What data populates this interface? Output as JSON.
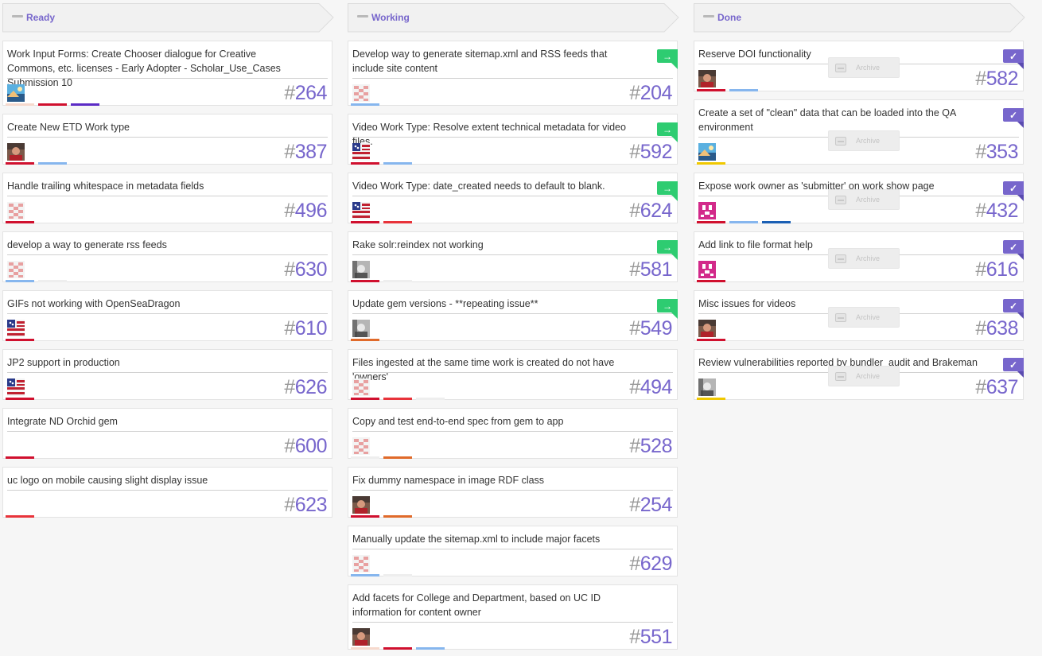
{
  "colors": {
    "accent": "#7766cc",
    "move_badge": "#2ecc71",
    "done_badge": "#7766cc",
    "label_red": "#d0102e",
    "label_lightred": "#e8333a",
    "label_purple": "#5b2bc5",
    "label_lightblue": "#86b6ee",
    "label_blue": "#1a5fb4",
    "label_orange": "#e06a2a",
    "label_yellow": "#f0c800",
    "label_grey": "#eeeeee",
    "label_peach": "#f6d9cd"
  },
  "columns": [
    {
      "key": "ready",
      "title": "Ready",
      "cards": [
        {
          "title": "Work Input Forms: Create Chooser dialogue for Creative Commons, etc. licenses - Early Adopter - Scholar_Use_Cases Submission 10",
          "number": "264",
          "avatar": "landscape",
          "labels": [
            "label_peach",
            "label_red",
            "label_purple"
          ]
        },
        {
          "title": "Create New ETD Work type",
          "number": "387",
          "avatar": "person",
          "labels": [
            "label_red",
            "label_lightblue"
          ]
        },
        {
          "title": "Handle trailing whitespace in metadata fields",
          "number": "496",
          "avatar": "identicon-pink",
          "labels": [
            "label_red"
          ]
        },
        {
          "title": "develop a way to generate rss feeds",
          "number": "630",
          "avatar": "identicon-pink",
          "labels": [
            "label_lightblue",
            "label_grey"
          ]
        },
        {
          "title": "GIFs not working with OpenSeaDragon",
          "number": "610",
          "avatar": "flag",
          "labels": [
            "label_red"
          ]
        },
        {
          "title": "JP2 support in production",
          "number": "626",
          "avatar": "flag",
          "labels": [
            "label_red"
          ]
        },
        {
          "title": "Integrate ND Orchid gem",
          "number": "600",
          "avatar": "none",
          "labels": [
            "label_red"
          ]
        },
        {
          "title": "uc logo on mobile causing slight display issue",
          "number": "623",
          "avatar": "none",
          "labels": [
            "label_lightred"
          ]
        }
      ]
    },
    {
      "key": "working",
      "title": "Working",
      "cards": [
        {
          "title": "Develop way to generate sitemap.xml and RSS feeds that include site content",
          "number": "204",
          "avatar": "identicon-pink",
          "labels": [
            "label_lightblue"
          ],
          "badge": "move"
        },
        {
          "title": "Video Work Type: Resolve extent technical metadata for video files.",
          "number": "592",
          "avatar": "flag",
          "labels": [
            "label_red",
            "label_lightblue"
          ],
          "badge": "move"
        },
        {
          "title": "Video Work Type: date_created needs to default to blank.",
          "number": "624",
          "avatar": "flag",
          "labels": [
            "label_red",
            "label_lightred"
          ],
          "badge": "move"
        },
        {
          "title": "Rake solr:reindex not working",
          "number": "581",
          "avatar": "grey-person",
          "labels": [
            "label_red",
            "label_grey"
          ],
          "badge": "move"
        },
        {
          "title": "Update gem versions - **repeating issue**",
          "number": "549",
          "avatar": "grey-person",
          "labels": [
            "label_orange"
          ],
          "badge": "move"
        },
        {
          "title": "Files ingested at the same time work is created do not have 'owners'",
          "number": "494",
          "avatar": "identicon-pink",
          "labels": [
            "label_red",
            "label_lightred",
            "label_grey"
          ]
        },
        {
          "title": "Copy and test end-to-end spec from gem to app",
          "number": "528",
          "avatar": "identicon-pink",
          "labels": [
            "label_grey",
            "label_orange"
          ]
        },
        {
          "title": "Fix dummy namespace in image RDF class",
          "number": "254",
          "avatar": "person",
          "labels": [
            "label_red",
            "label_orange"
          ]
        },
        {
          "title": "Manually update the sitemap.xml to include major facets",
          "number": "629",
          "avatar": "identicon-pink",
          "labels": [
            "label_lightblue",
            "label_grey"
          ]
        },
        {
          "title": "Add facets for College and Department, based on UC ID information for content owner",
          "number": "551",
          "avatar": "person",
          "labels": [
            "label_peach",
            "label_red",
            "label_lightblue"
          ]
        }
      ]
    },
    {
      "key": "done",
      "title": "Done",
      "archive_label": "Archive",
      "cards": [
        {
          "title": "Reserve DOI functionality",
          "number": "582",
          "avatar": "person",
          "labels": [
            "label_red",
            "label_lightblue"
          ],
          "badge": "done"
        },
        {
          "title": "Create a set of \"clean\" data that can be loaded into the QA environment",
          "number": "353",
          "avatar": "landscape",
          "labels": [
            "label_yellow"
          ],
          "badge": "done"
        },
        {
          "title": "Expose work owner as 'submitter' on work show page",
          "number": "432",
          "avatar": "identicon-magenta",
          "labels": [
            "label_red",
            "label_lightblue",
            "label_blue"
          ],
          "badge": "done"
        },
        {
          "title": "Add link to file format help",
          "number": "616",
          "avatar": "identicon-magenta",
          "labels": [
            "label_red"
          ],
          "badge": "done"
        },
        {
          "title": "Misc issues for videos",
          "number": "638",
          "avatar": "person",
          "labels": [
            "label_red"
          ],
          "badge": "done"
        },
        {
          "title": "Review vulnerabilities reported by bundler_audit and Brakeman",
          "number": "637",
          "avatar": "grey-person",
          "labels": [
            "label_yellow"
          ],
          "badge": "done"
        }
      ]
    }
  ]
}
